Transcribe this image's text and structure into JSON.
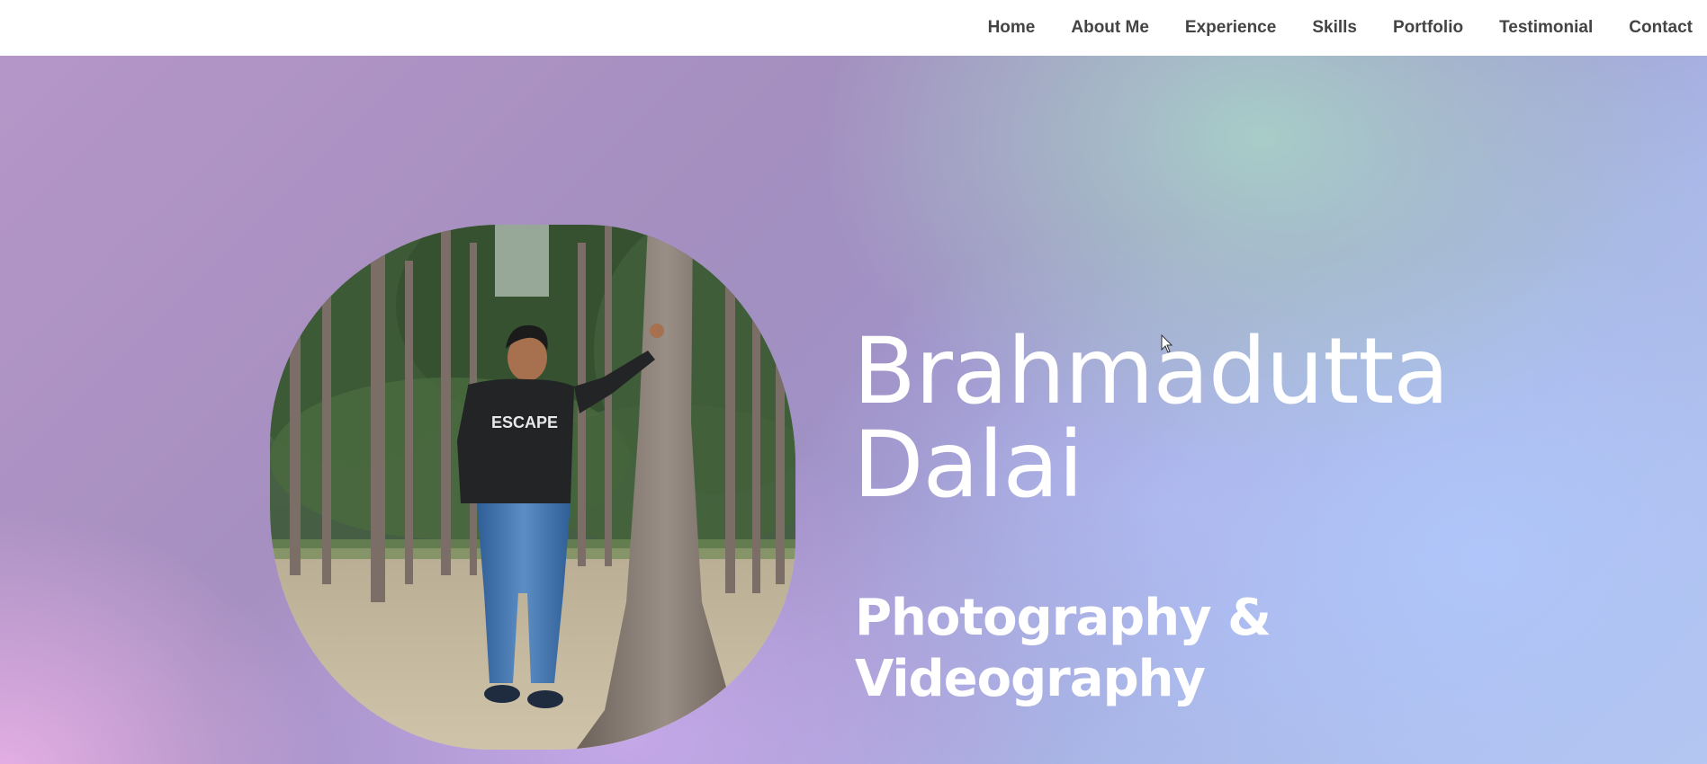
{
  "nav": {
    "items": [
      {
        "label": "Home"
      },
      {
        "label": "About Me"
      },
      {
        "label": "Experience"
      },
      {
        "label": "Skills"
      },
      {
        "label": "Portfolio"
      },
      {
        "label": "Testimonial"
      },
      {
        "label": "Contact"
      }
    ]
  },
  "hero": {
    "name_line1": "Brahmadutta",
    "name_line2": "Dalai",
    "subtitle_line1": "Photography &",
    "subtitle_line2": "Videography",
    "portrait": {
      "shirt_text": "ESCAPE"
    }
  },
  "colors": {
    "nav_text": "#444444",
    "hero_text": "#ffffff",
    "gradient_purple": "#a48fc0",
    "gradient_teal": "#a8d0c8",
    "gradient_blue": "#b0c6fa",
    "gradient_pink": "#e8b0e6"
  }
}
